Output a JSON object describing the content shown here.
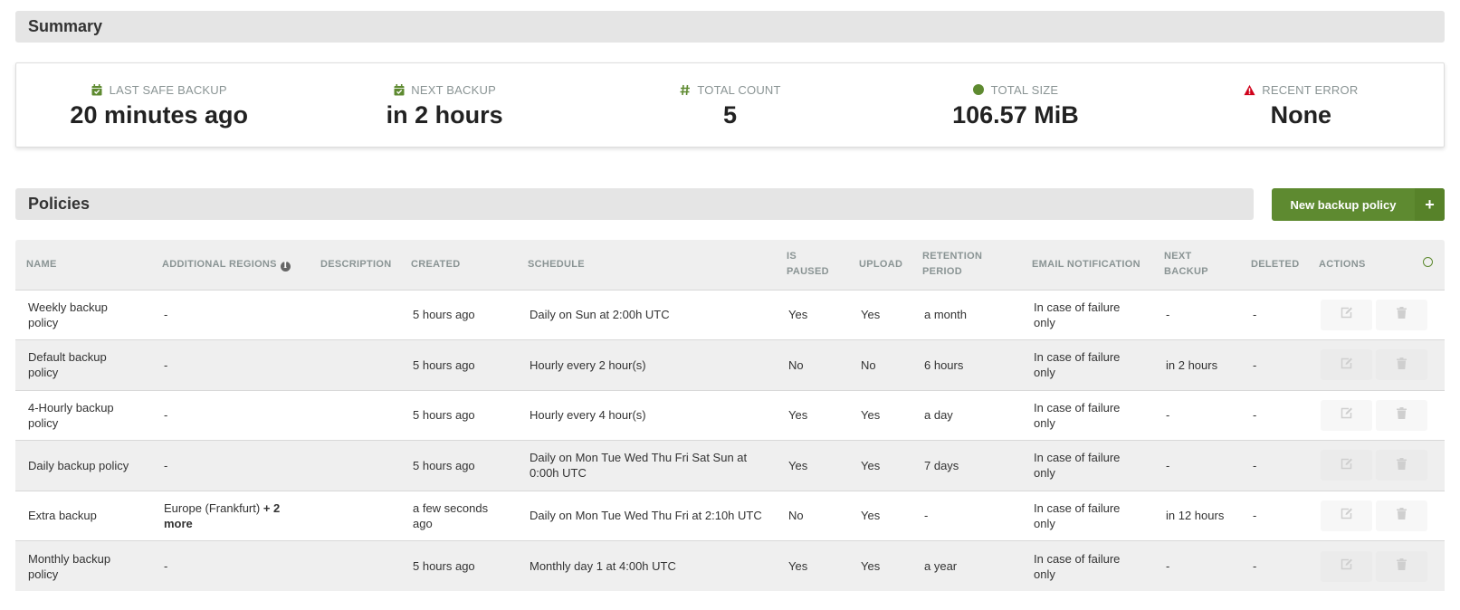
{
  "summary": {
    "title": "Summary",
    "stats": [
      {
        "icon": "calendar-check-icon",
        "label": "Last safe backup",
        "value": "20 minutes ago"
      },
      {
        "icon": "calendar-check-icon",
        "label": "Next backup",
        "value": "in 2 hours"
      },
      {
        "icon": "hash-icon",
        "label": "Total count",
        "value": "5"
      },
      {
        "icon": "circle-icon",
        "label": "Total size",
        "value": "106.57 MiB"
      },
      {
        "icon": "warning-triangle-icon",
        "label": "Recent error",
        "value": "None"
      }
    ]
  },
  "policies": {
    "title": "Policies",
    "new_button_label": "New backup policy",
    "new_button_icon": "+",
    "columns": [
      "Name",
      "Additional regions",
      "Description",
      "Created",
      "Schedule",
      "Is paused",
      "Upload",
      "Retention period",
      "Email notification",
      "Next backup",
      "Deleted",
      "Actions"
    ],
    "rows": [
      {
        "name": "Weekly backup policy",
        "regions": "-",
        "regions_more": "",
        "description": "",
        "created": "5 hours ago",
        "schedule": "Daily on Sun at 2:00h UTC",
        "paused": "Yes",
        "upload": "Yes",
        "retention": "a month",
        "email": "In case of failure only",
        "next_backup": "-",
        "deleted": "-"
      },
      {
        "name": "Default backup policy",
        "regions": "-",
        "regions_more": "",
        "description": "",
        "created": "5 hours ago",
        "schedule": "Hourly every 2 hour(s)",
        "paused": "No",
        "upload": "No",
        "retention": "6 hours",
        "email": "In case of failure only",
        "next_backup": "in 2 hours",
        "deleted": "-"
      },
      {
        "name": "4-Hourly backup policy",
        "regions": "-",
        "regions_more": "",
        "description": "",
        "created": "5 hours ago",
        "schedule": "Hourly every 4 hour(s)",
        "paused": "Yes",
        "upload": "Yes",
        "retention": "a day",
        "email": "In case of failure only",
        "next_backup": "-",
        "deleted": "-"
      },
      {
        "name": "Daily backup policy",
        "regions": "-",
        "regions_more": "",
        "description": "",
        "created": "5 hours ago",
        "schedule": "Daily on Mon Tue Wed Thu Fri Sat Sun at 0:00h UTC",
        "paused": "Yes",
        "upload": "Yes",
        "retention": "7 days",
        "email": "In case of failure only",
        "next_backup": "-",
        "deleted": "-"
      },
      {
        "name": "Extra backup",
        "regions": "Europe (Frankfurt)",
        "regions_more": "+ 2 more",
        "description": "",
        "created": "a few seconds ago",
        "schedule": "Daily on Mon Tue Wed Thu Fri at 2:10h UTC",
        "paused": "No",
        "upload": "Yes",
        "retention": "-",
        "email": "In case of failure only",
        "next_backup": "in 12 hours",
        "deleted": "-"
      },
      {
        "name": "Monthly backup policy",
        "regions": "-",
        "regions_more": "",
        "description": "",
        "created": "5 hours ago",
        "schedule": "Monthly day 1 at 4:00h UTC",
        "paused": "Yes",
        "upload": "Yes",
        "retention": "a year",
        "email": "In case of failure only",
        "next_backup": "-",
        "deleted": "-"
      }
    ]
  },
  "colors": {
    "accent": "#5e8a30",
    "error": "#d0021b",
    "header_bg": "#e5e5e5",
    "row_alt": "#efefef"
  }
}
